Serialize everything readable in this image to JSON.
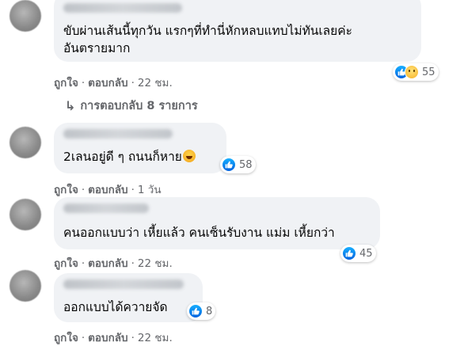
{
  "comments": [
    {
      "text_lines": [
        "ขับผ่านเส้นนี้ทุกวัน แรกๆที่ทำนี่หักหลบแทบไม่ทันเลยค่ะ",
        "อันตรายมาก"
      ],
      "reaction_count": "55",
      "reaction_icons": [
        "like-icon",
        "sad-icon"
      ],
      "actions": {
        "like": "ถูกใจ",
        "reply": "ตอบกลับ",
        "time": "22 ชม."
      },
      "replies_label": "การตอบกลับ 8 รายการ"
    },
    {
      "text": "2เลนอยู่ดี ๆ ถนนก็หาย",
      "emoji": "laughing-crying-emoji",
      "reaction_count": "58",
      "reaction_icons": [
        "like-icon"
      ],
      "actions": {
        "like": "ถูกใจ",
        "reply": "ตอบกลับ",
        "time": "1 วัน"
      }
    },
    {
      "text": "คนออกแบบว่า เหี้ยแล้ว คนเซ็นรับงาน แม่ม เหี้ยกว่า",
      "reaction_count": "45",
      "reaction_icons": [
        "like-icon"
      ],
      "actions": {
        "like": "ถูกใจ",
        "reply": "ตอบกลับ",
        "time": "22 ชม."
      }
    },
    {
      "text": "ออกแบบได้ควายจัด",
      "reaction_count": "8",
      "reaction_icons": [
        "like-icon"
      ],
      "actions": {
        "like": "ถูกใจ",
        "reply": "ตอบกลับ",
        "time": "22 ชม."
      }
    }
  ],
  "separator": "·",
  "reply_arrow_icon": "reply-arrow-icon",
  "colors": {
    "bubble": "#f0f2f5",
    "secondary_text": "#65676b",
    "like_blue": "#1877f2"
  }
}
